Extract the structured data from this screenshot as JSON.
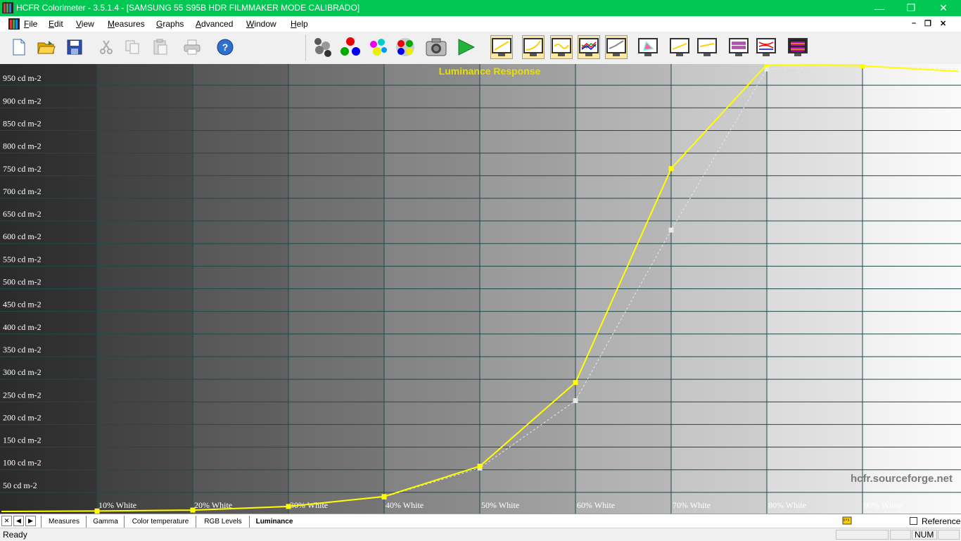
{
  "window": {
    "title": "HCFR Colorimeter - 3.5.1.4 - [SAMSUNG 55 S95B HDR FILMMAKER MODE CALIBRADO]",
    "minimize": "—",
    "restore": "❐",
    "close": "✕"
  },
  "menu": {
    "items": [
      {
        "pre": "",
        "u": "F",
        "post": "ile"
      },
      {
        "pre": "",
        "u": "E",
        "post": "dit"
      },
      {
        "pre": "",
        "u": "V",
        "post": "iew"
      },
      {
        "pre": "",
        "u": "M",
        "post": "easures"
      },
      {
        "pre": "",
        "u": "G",
        "post": "raphs"
      },
      {
        "pre": "",
        "u": "A",
        "post": "dvanced"
      },
      {
        "pre": "",
        "u": "W",
        "post": "indow"
      },
      {
        "pre": "",
        "u": "H",
        "post": "elp"
      }
    ],
    "mdi_controls": [
      "–",
      "❐",
      "✕"
    ]
  },
  "tabs": {
    "items": [
      "Measures",
      "Gamma",
      "Color temperature",
      "RGB Levels",
      "Luminance"
    ],
    "active": "Luminance",
    "nav": [
      "✕",
      "◀",
      "▶"
    ],
    "reference_label": "Reference"
  },
  "status": {
    "ready": "Ready",
    "num": "NUM"
  },
  "colors": {
    "measured": "#ffff00",
    "reference": "#e8e8e8",
    "title": "#e8e000",
    "grid": "#1f4a4a",
    "titlebar": "#00c853"
  },
  "chart_data": {
    "type": "line",
    "title": "Luminance Response",
    "watermark": "hcfr.sourceforge.net",
    "x": [
      0,
      10,
      20,
      30,
      40,
      50,
      60,
      70,
      80,
      90,
      100
    ],
    "x_tick_labels": [
      "10% White",
      "20% White",
      "30% White",
      "40% White",
      "50% White",
      "60% White",
      "70% White",
      "80% White",
      "90% White"
    ],
    "xlim": [
      0,
      100
    ],
    "ylim": [
      0,
      1000
    ],
    "y_ticks": [
      50,
      100,
      150,
      200,
      250,
      300,
      350,
      400,
      450,
      500,
      550,
      600,
      650,
      700,
      750,
      800,
      850,
      900,
      950
    ],
    "y_tick_suffix": " cd m-2",
    "grid": true,
    "background": "grayscale gradient 0% to 100% White",
    "series": [
      {
        "values": [
          0,
          1,
          3,
          11,
          33,
          100,
          285,
          758,
          988,
          985,
          973
        ]
      },
      {
        "values": [
          0,
          1,
          3,
          11,
          32,
          96,
          245,
          622,
          978,
          985,
          978
        ]
      }
    ]
  }
}
